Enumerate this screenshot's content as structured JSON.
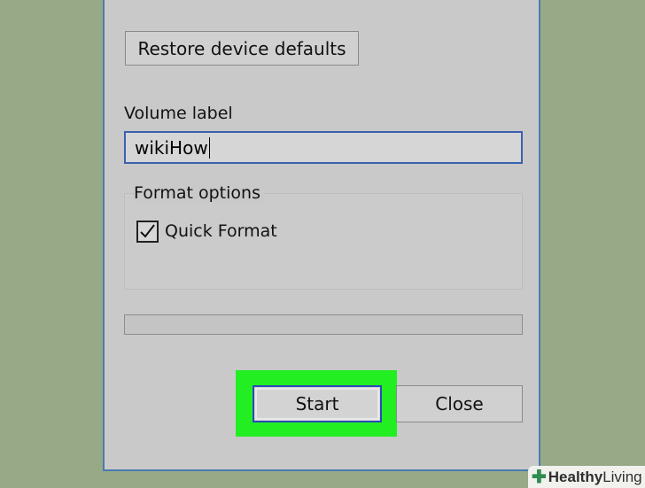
{
  "dialog": {
    "restore_button": "Restore device defaults",
    "volume_label_title": "Volume label",
    "volume_label_value": "wikiHow",
    "format_options_title": "Format options",
    "quick_format_label": "Quick Format",
    "quick_format_checked": true,
    "progress_fraction": 0,
    "start_button": "Start",
    "close_button": "Close"
  },
  "watermark": {
    "brand_bold": "Healthy",
    "brand_light": " Living",
    "icon": "plus-icon"
  },
  "colors": {
    "background": "#97a987",
    "highlight": "#22ee22",
    "focus_border": "#2b49b9"
  }
}
